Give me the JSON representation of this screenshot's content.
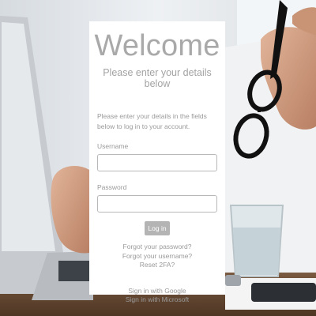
{
  "login": {
    "welcome": "Welcome",
    "subtitle": "Please enter your details below",
    "intro": "Please enter your details in the fields below to log in to your account.",
    "username_label": "Username",
    "username_value": "",
    "password_label": "Password",
    "password_value": "",
    "login_button": "Log in",
    "forgot_password": "Forgot your password?",
    "forgot_username": "Forgot your username?",
    "reset_2fa": "Reset 2FA?",
    "sso_google": "Sign in with Google",
    "sso_microsoft": "Sign in with Microsoft"
  },
  "colors": {
    "card_background": "#ffffff",
    "text_muted": "#9a9a9a",
    "button": "#b4b4b4"
  }
}
